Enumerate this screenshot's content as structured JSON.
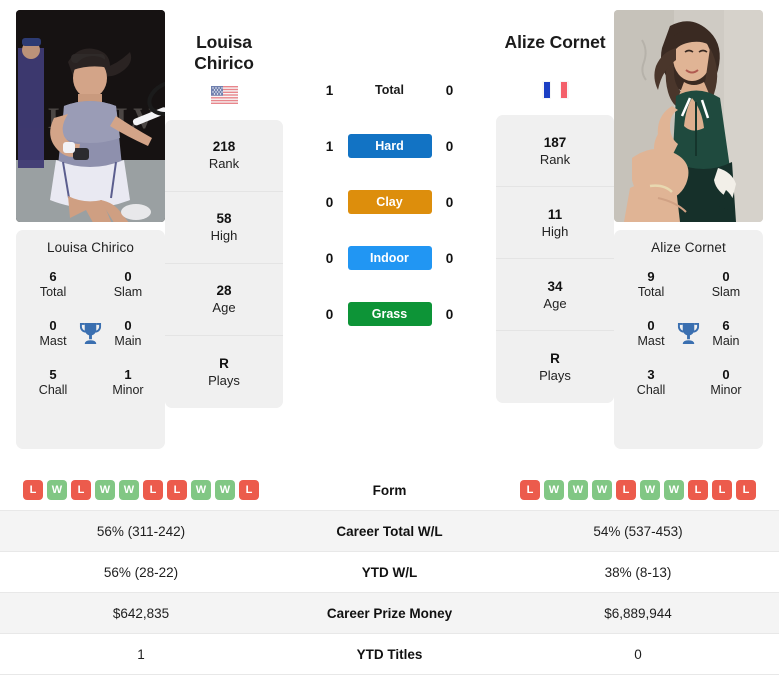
{
  "players": {
    "left": {
      "first_name": "Louisa",
      "last_name": "Chirico",
      "full_name": "Louisa Chirico",
      "flag": "us-flag-icon",
      "rank": "218",
      "rank_label": "Rank",
      "high": "58",
      "high_label": "High",
      "age": "28",
      "age_label": "Age",
      "plays": "R",
      "plays_label": "Plays",
      "titles": {
        "total": "6",
        "total_label": "Total",
        "slam": "0",
        "slam_label": "Slam",
        "mast": "0",
        "mast_label": "Mast",
        "main": "0",
        "main_label": "Main",
        "chall": "5",
        "chall_label": "Chall",
        "minor": "1",
        "minor_label": "Minor"
      },
      "form": [
        "L",
        "W",
        "L",
        "W",
        "W",
        "L",
        "L",
        "W",
        "W",
        "L"
      ],
      "career_total_wl": "56% (311-242)",
      "ytd_wl": "56% (28-22)",
      "career_prize_money": "$642,835",
      "ytd_titles": "1"
    },
    "right": {
      "first_name": "Alize",
      "last_name": "Cornet",
      "full_name": "Alize Cornet",
      "flag": "fr-flag-icon",
      "rank": "187",
      "rank_label": "Rank",
      "high": "11",
      "high_label": "High",
      "age": "34",
      "age_label": "Age",
      "plays": "R",
      "plays_label": "Plays",
      "titles": {
        "total": "9",
        "total_label": "Total",
        "slam": "0",
        "slam_label": "Slam",
        "mast": "0",
        "mast_label": "Mast",
        "main": "6",
        "main_label": "Main",
        "chall": "3",
        "chall_label": "Chall",
        "minor": "0",
        "minor_label": "Minor"
      },
      "form": [
        "L",
        "W",
        "W",
        "W",
        "L",
        "W",
        "W",
        "L",
        "L",
        "L"
      ],
      "career_total_wl": "54% (537-453)",
      "ytd_wl": "38% (8-13)",
      "career_prize_money": "$6,889,944",
      "ytd_titles": "0"
    }
  },
  "head_to_head": {
    "rows": [
      {
        "label": "Total",
        "left": "1",
        "right": "0",
        "pill": false,
        "color": ""
      },
      {
        "label": "Hard",
        "left": "1",
        "right": "0",
        "pill": true,
        "color": "#1273c4"
      },
      {
        "label": "Clay",
        "left": "0",
        "right": "0",
        "pill": true,
        "color": "#dd8e0c"
      },
      {
        "label": "Indoor",
        "left": "0",
        "right": "0",
        "pill": true,
        "color": "#2196f3"
      },
      {
        "label": "Grass",
        "left": "0",
        "right": "0",
        "pill": true,
        "color": "#0d9437"
      }
    ]
  },
  "stats_table": {
    "rows": [
      {
        "label": "Form",
        "left": "",
        "right": "",
        "type": "form"
      },
      {
        "label": "Career Total W/L",
        "left": "56% (311-242)",
        "right": "54% (537-453)",
        "type": "text"
      },
      {
        "label": "YTD W/L",
        "left": "56% (28-22)",
        "right": "38% (8-13)",
        "type": "text"
      },
      {
        "label": "Career Prize Money",
        "left": "$642,835",
        "right": "$6,889,944",
        "type": "text"
      },
      {
        "label": "YTD Titles",
        "left": "1",
        "right": "0",
        "type": "text"
      }
    ]
  },
  "colors": {
    "hard": "#1273c4",
    "clay": "#dd8e0c",
    "indoor": "#2196f3",
    "grass": "#0d9437",
    "win_badge": "#81c784",
    "loss_badge": "#ec5b4c",
    "trophy": "#3a6fb0",
    "card_bg": "#f0f0f0"
  }
}
